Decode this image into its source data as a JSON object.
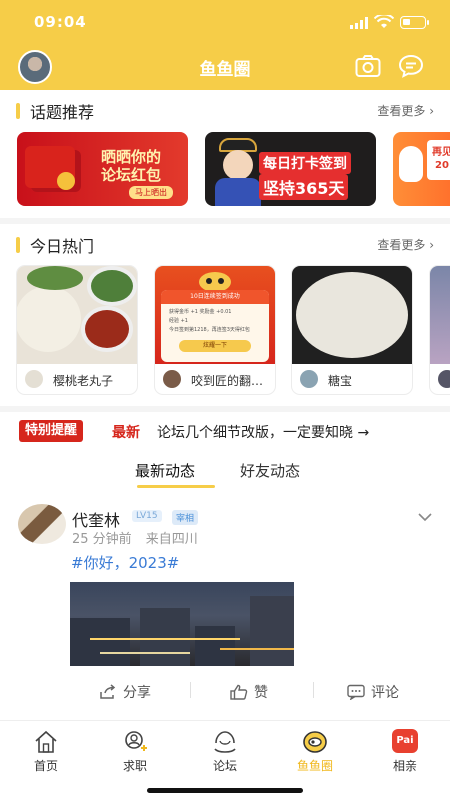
{
  "status": {
    "time": "09:04"
  },
  "header": {
    "title": "鱼鱼圈"
  },
  "topics": {
    "title": "话题推荐",
    "more": "查看更多",
    "banners": [
      {
        "line1": "晒晒你的",
        "line2": "论坛红包",
        "cta": "马上晒出"
      },
      {
        "line1": "每日打卡签到",
        "line2": "坚持365天"
      },
      {
        "line1": "再见",
        "line2": "20"
      }
    ]
  },
  "hot": {
    "title": "今日热门",
    "more": "查看更多",
    "cards": [
      {
        "name": "樱桃老丸子"
      },
      {
        "name": "咬到匠的翻…",
        "popup_title": "10日连续签到成功",
        "popup_rows": "获得金币 +1  奖励金 +0.01\n经验 +1\n今日签到第1218，再连签3天得红包",
        "popup_button": "炫耀一下"
      },
      {
        "name": "糖宝"
      }
    ]
  },
  "notice": {
    "tag": "特别提醒",
    "new": "最新",
    "text": "论坛几个细节改版，一定要知晓 →"
  },
  "feed": {
    "tabs": [
      "最新动态",
      "好友动态"
    ],
    "post": {
      "author": "代奎林",
      "level": "LV15",
      "role": "宰相",
      "time": "25 分钟前",
      "location": "来自四川",
      "topic": "#你好，2023#",
      "actions": [
        "分享",
        "赞",
        "评论"
      ]
    }
  },
  "tabbar": {
    "items": [
      "首页",
      "求职",
      "论坛",
      "鱼鱼圈",
      "相亲"
    ],
    "pai_label": "Pai",
    "active": "鱼鱼圈"
  },
  "colors": {
    "brand": "#f6cd48",
    "accent_red": "#d6261c",
    "link_blue": "#3a7bd5"
  }
}
